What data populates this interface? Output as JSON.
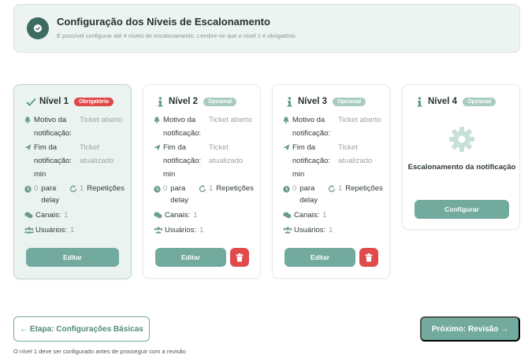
{
  "banner": {
    "icon": "check-circle-icon",
    "title": "Configuração dos Níveis de Escalonamento",
    "subtitle": "É possível configurar até 4 níveis de escalonamento. Lembre-se que o nível 1 é obrigatório."
  },
  "labels": {
    "motivo": "Motivo da notificação:",
    "fim": "Fim da notificação:",
    "para_delay": "para delay",
    "repeticoes": "Repetições",
    "canais": "Canais:",
    "usuarios": "Usuários:",
    "min": "min"
  },
  "levels": [
    {
      "title": "Nível 1",
      "badge": "Obrigatório",
      "status_icon": "check-icon",
      "motivo": "Ticket aberto",
      "fim": "Ticket atualizado",
      "delay": "0",
      "repeticoes": "1",
      "canais": "1",
      "usuarios": "1",
      "edit_label": "Editar"
    },
    {
      "title": "Nível 2",
      "badge": "Opcional",
      "status_icon": "info-icon",
      "motivo": "Ticket aberto",
      "fim": "Ticket atualizado",
      "delay": "0",
      "repeticoes": "1",
      "canais": "1",
      "usuarios": "1",
      "edit_label": "Editar"
    },
    {
      "title": "Nível 3",
      "badge": "Opcional",
      "status_icon": "info-icon",
      "motivo": "Ticket aberto",
      "fim": "Ticket atualizado",
      "delay": "0",
      "repeticoes": "1",
      "canais": "1",
      "usuarios": "1",
      "edit_label": "Editar"
    },
    {
      "title": "Nível 4",
      "badge": "Opcional",
      "status_icon": "info-icon",
      "message": "Escalonamento da notificação",
      "configure_label": "Configurar"
    }
  ],
  "footer": {
    "back_label": "← Etapa: Configurações Básicas",
    "next_label": "Próximo: Revisão →",
    "note": "O nível 1 deve ser configurado antes de prosseguir com a revisão"
  },
  "colors": {
    "accent": "#72aa9d",
    "danger": "#e04848",
    "banner_bg": "#edf3f1"
  }
}
